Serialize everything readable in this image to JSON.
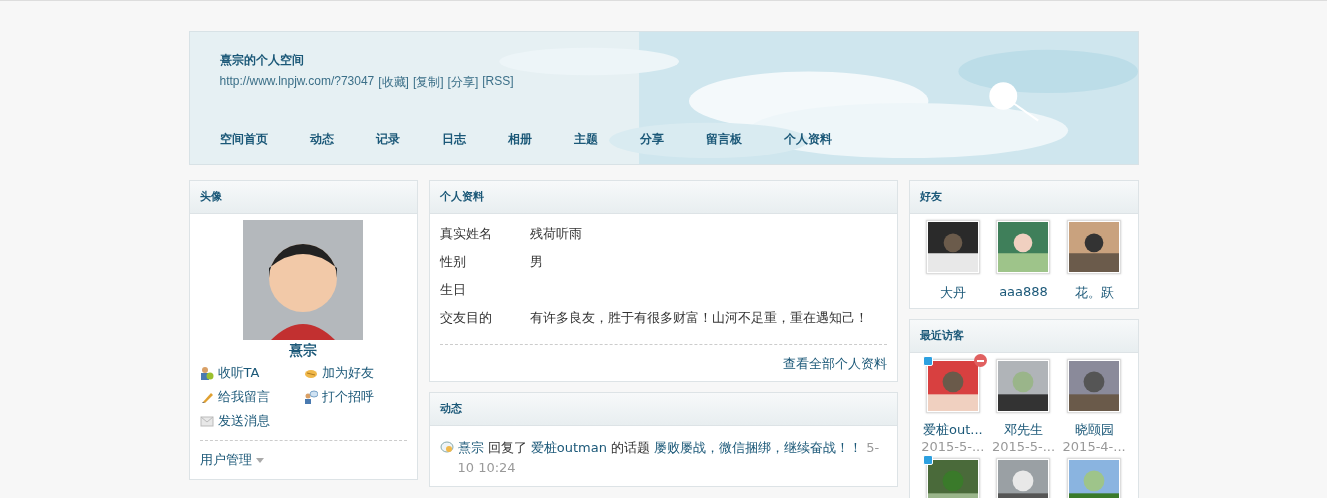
{
  "header": {
    "title": "熹宗的个人空间",
    "url": "http://www.lnpjw.com/?73047",
    "links": [
      "[收藏]",
      "[复制]",
      "[分享]",
      "[RSS]"
    ],
    "nav": [
      {
        "label": "空间首页"
      },
      {
        "label": "动态"
      },
      {
        "label": "记录"
      },
      {
        "label": "日志"
      },
      {
        "label": "相册"
      },
      {
        "label": "主题"
      },
      {
        "label": "分享"
      },
      {
        "label": "留言板"
      },
      {
        "label": "个人资料"
      }
    ]
  },
  "avatar_panel": {
    "title": "头像",
    "name": "熹宗",
    "actions": [
      {
        "kind": "follow",
        "label": "收听TA"
      },
      {
        "kind": "friend",
        "label": "加为好友"
      },
      {
        "kind": "message",
        "label": "给我留言"
      },
      {
        "kind": "greet",
        "label": "打个招呼"
      },
      {
        "kind": "mail",
        "label": "发送消息"
      }
    ],
    "manage": "用户管理"
  },
  "profile": {
    "title": "个人资料",
    "rows": [
      {
        "label": "真实姓名",
        "value": "残荷听雨"
      },
      {
        "label": "性别",
        "value": "男"
      },
      {
        "label": "生日"
      },
      {
        "label": "交友目的",
        "value": "有许多良友，胜于有很多财富！山河不足重，重在遇知己！"
      }
    ],
    "more": "查看全部个人资料"
  },
  "feed": {
    "title": "动态",
    "items": [
      {
        "user": "熹宗",
        "verb": "回复了",
        "target": "爱桩outman",
        "mid": "的话题",
        "topic": "屡败屡战，微信捆绑，继续奋战！！",
        "time": "5-10 10:24"
      }
    ]
  },
  "friends": {
    "title": "好友",
    "items": [
      {
        "name": "大丹"
      },
      {
        "name": "aaa888"
      },
      {
        "name": "花。跃"
      }
    ]
  },
  "visitors": {
    "title": "最近访客",
    "items": [
      {
        "name": "爱桩out...",
        "time": "2015-5-...",
        "online": true,
        "removable": true
      },
      {
        "name": "邓先生",
        "time": "2015-5-...",
        "online": false,
        "removable": false
      },
      {
        "name": "晓颐园",
        "time": "2015-4-...",
        "online": false,
        "removable": false
      },
      {
        "online": true,
        "removable": false
      },
      {
        "online": false,
        "removable": false
      },
      {
        "online": false,
        "removable": false
      }
    ]
  }
}
